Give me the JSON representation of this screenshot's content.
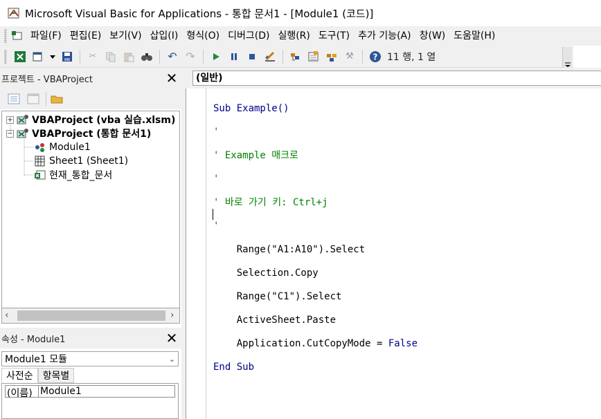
{
  "window": {
    "title": "Microsoft Visual Basic for Applications - 통합 문서1 - [Module1 (코드)]"
  },
  "menu": {
    "items": [
      "파일(F)",
      "편집(E)",
      "보기(V)",
      "삽입(I)",
      "형식(O)",
      "디버그(D)",
      "실행(R)",
      "도구(T)",
      "추가 기능(A)",
      "창(W)",
      "도움말(H)"
    ]
  },
  "toolbar": {
    "cursor_position": "11 행, 1 열"
  },
  "project_panel": {
    "title": "프로젝트 - VBAProject",
    "tree": [
      {
        "label": "VBAProject (vba 실습.xlsm)",
        "expander": "+"
      },
      {
        "label": "VBAProject (통합 문서1)",
        "expander": "−"
      },
      {
        "label": "Module1"
      },
      {
        "label": "Sheet1 (Sheet1)"
      },
      {
        "label": "현재_통합_문서"
      }
    ]
  },
  "properties_panel": {
    "title": "속성 - Module1",
    "object_select": "Module1 모듈",
    "tabs": [
      "사전순",
      "항목별"
    ],
    "rows": [
      {
        "name": "(이름)",
        "value": "Module1"
      }
    ]
  },
  "code_window": {
    "object_dropdown": "(일반)",
    "lines": [
      {
        "text": "Sub Example()",
        "kind": "keyword"
      },
      {
        "text": "'",
        "kind": "comment"
      },
      {
        "text": "' Example 매크로",
        "kind": "comment"
      },
      {
        "text": "'",
        "kind": "comment"
      },
      {
        "text": "' 바로 가기 키: Ctrl+j",
        "kind": "comment"
      },
      {
        "text": "'",
        "kind": "comment"
      },
      {
        "text": "    Range(\"A1:A10\").Select",
        "kind": "text"
      },
      {
        "text": "    Selection.Copy",
        "kind": "text"
      },
      {
        "text": "    Range(\"C1\").Select",
        "kind": "text"
      },
      {
        "text": "    ActiveSheet.Paste",
        "kind": "text"
      },
      {
        "text": "    Application.CutCopyMode = False",
        "kind": "text"
      },
      {
        "text": "End Sub",
        "kind": "keyword"
      }
    ]
  },
  "colors": {
    "keyword": "#00008b",
    "comment": "#008000",
    "panel_bg": "#f0f0f0"
  }
}
